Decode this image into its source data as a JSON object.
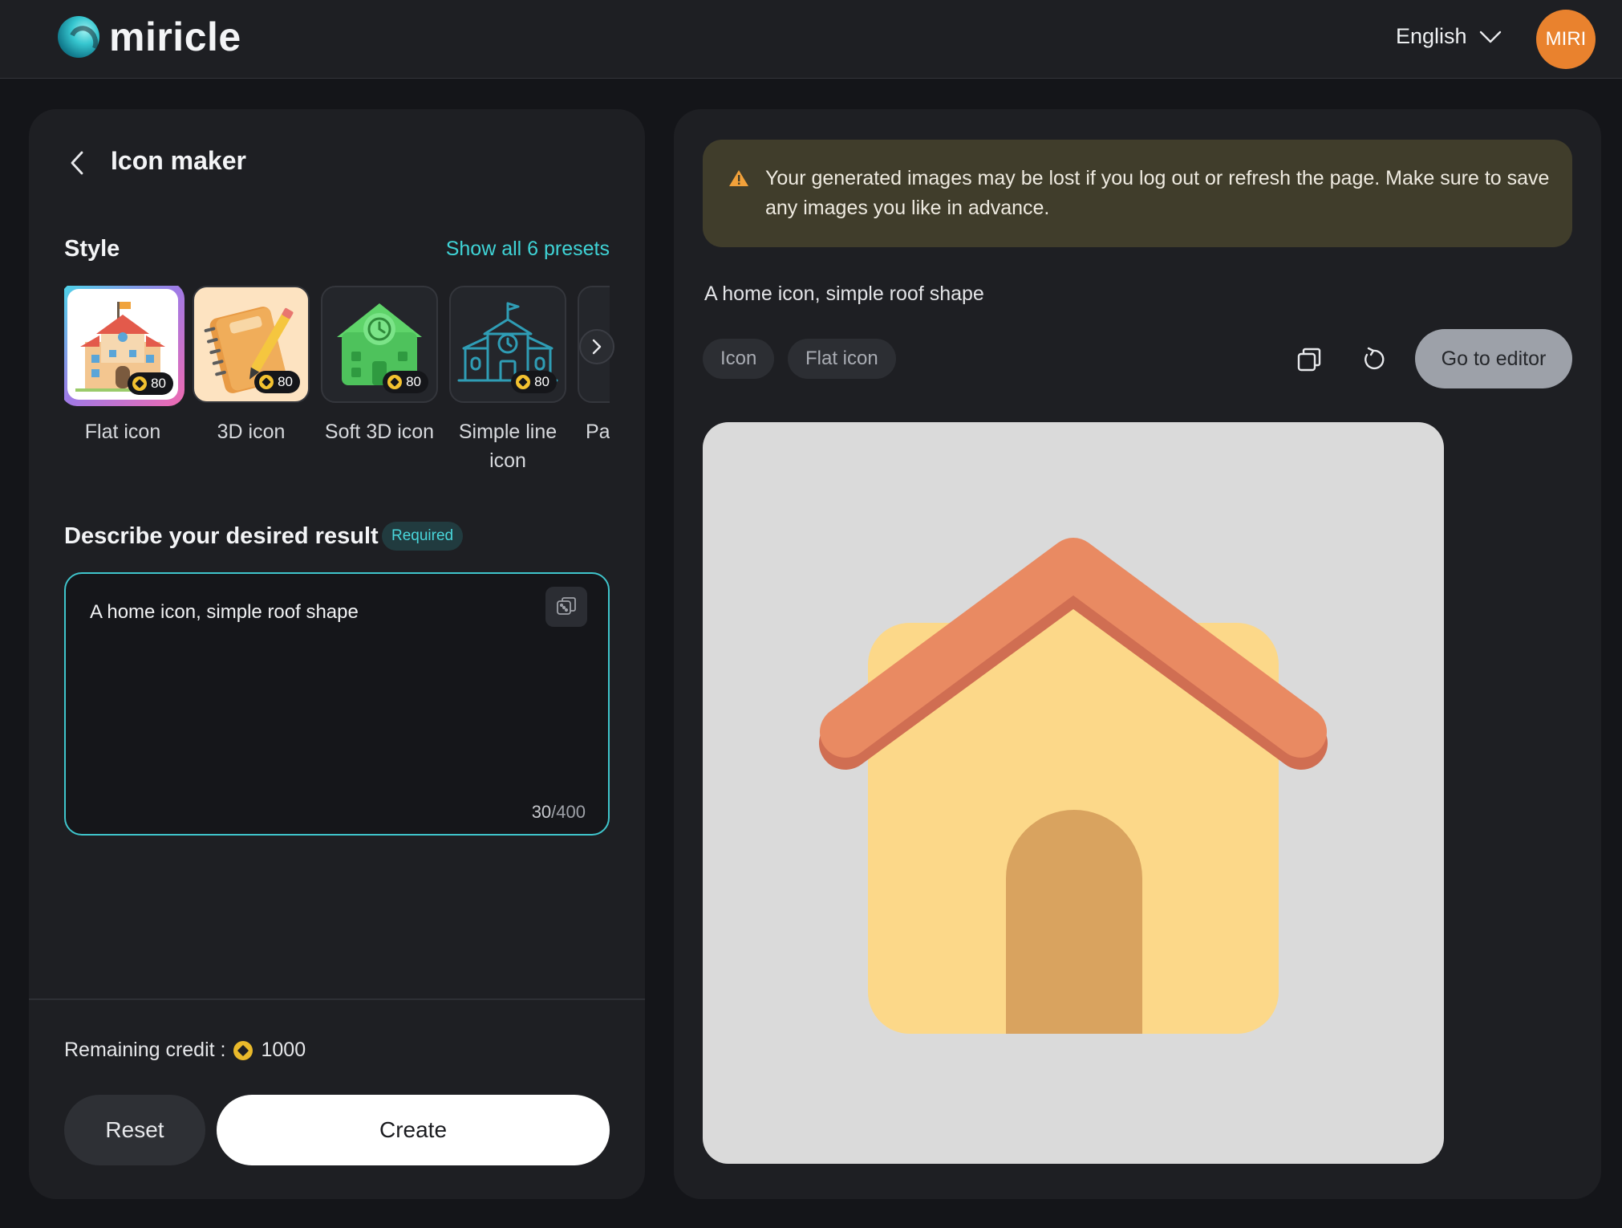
{
  "app": {
    "name": "miricle",
    "language": "English",
    "avatar_initials": "MIRI"
  },
  "colors": {
    "accent": "#3fd3d6",
    "avatar": "#e9822e",
    "warning_bg": "#403d2b",
    "warning_icon": "#f2a13a"
  },
  "sidebar": {
    "title": "Icon maker",
    "style_label": "Style",
    "show_presets": "Show all 6 presets",
    "presets": [
      {
        "name": "Flat icon",
        "cost": "80",
        "selected": true,
        "icon": "school-building-flat-icon"
      },
      {
        "name": "3D icon",
        "cost": "80",
        "selected": false,
        "icon": "notebook-pencil-3d-icon"
      },
      {
        "name": "Soft 3D icon",
        "cost": "80",
        "selected": false,
        "icon": "green-school-soft-3d-icon"
      },
      {
        "name": "Simple line icon",
        "cost": "80",
        "selected": false,
        "icon": "school-line-icon"
      },
      {
        "name": "Pa",
        "cost": "",
        "selected": false,
        "icon": "partial-preset-icon"
      }
    ],
    "describe_label": "Describe your desired result",
    "required_label": "Required",
    "prompt_value": "A home icon, simple roof shape",
    "char_count": "30",
    "char_limit": "/400",
    "credit_label": "Remaining credit :",
    "credit_value": "1000",
    "reset_label": "Reset",
    "create_label": "Create"
  },
  "result": {
    "warning": "Your generated images may be lost if you log out or refresh the page. Make sure to save any images you like in advance.",
    "prompt": "A home icon, simple roof shape",
    "tags": [
      "Icon",
      "Flat icon"
    ],
    "editor_label": "Go to editor",
    "image_icon": "house-icon"
  }
}
